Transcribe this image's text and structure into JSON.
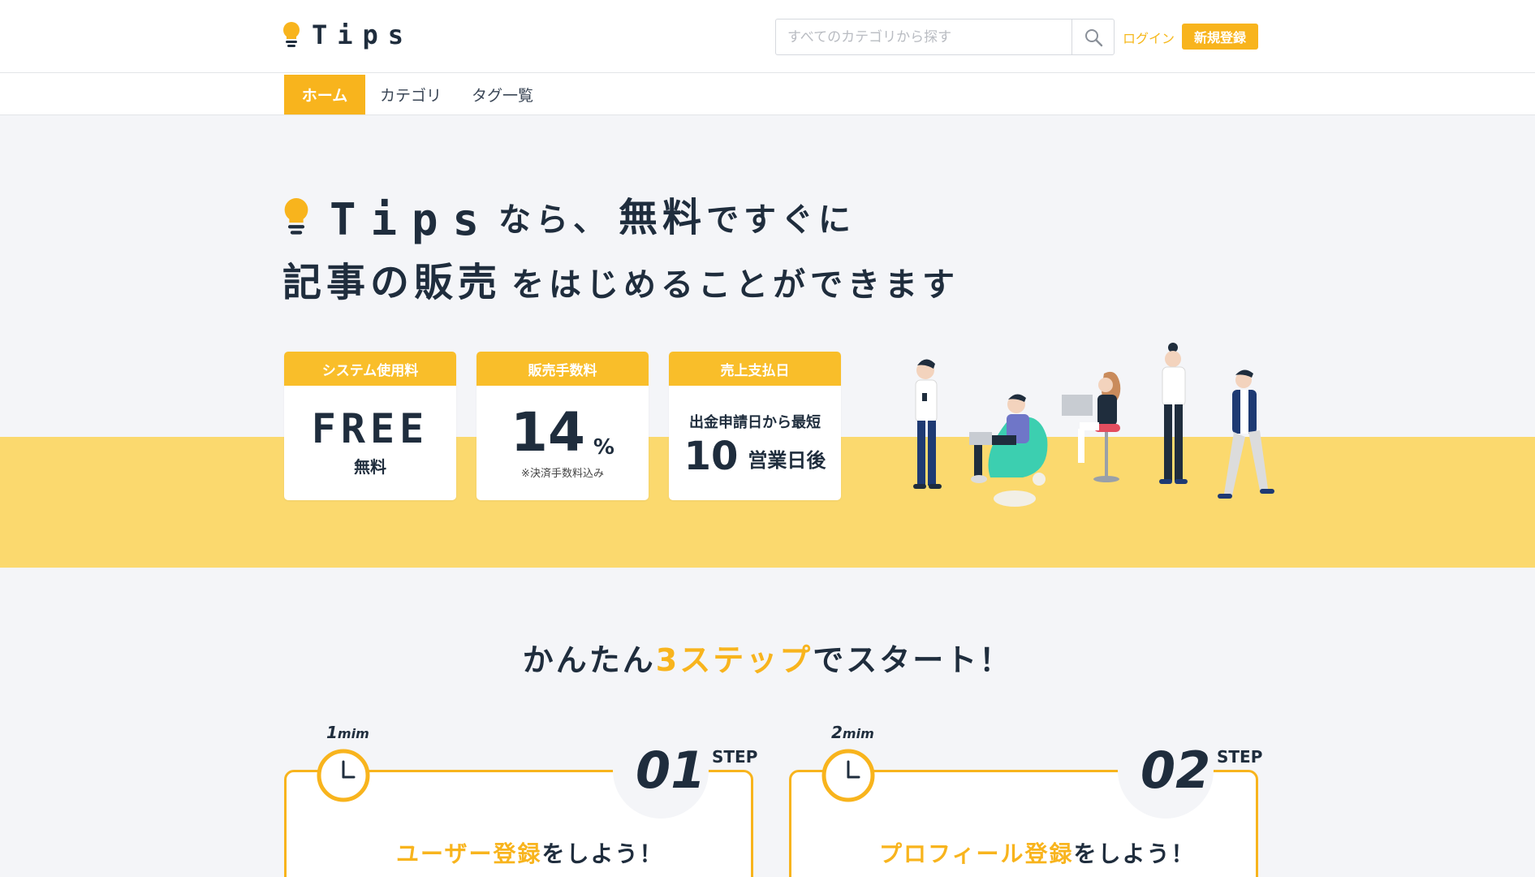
{
  "header": {
    "logo_text": "Tips",
    "search_placeholder": "すべてのカテゴリから探す",
    "login_label": "ログイン",
    "signup_label": "新規登録"
  },
  "nav": {
    "items": [
      {
        "label": "ホーム",
        "active": true
      },
      {
        "label": "カテゴリ",
        "active": false
      },
      {
        "label": "タグ一覧",
        "active": false
      }
    ]
  },
  "hero": {
    "brand": "Tips",
    "line1_part1": "なら、",
    "line1_part2": "無料",
    "line1_part3": "ですぐに",
    "line2_part1": "記事の販売",
    "line2_part2": "をはじめることができます"
  },
  "features": [
    {
      "head": "システム使用料",
      "value": "FREE",
      "sub": "無料"
    },
    {
      "head": "販売手数料",
      "value": "14",
      "unit": "%",
      "note": "※決済手数料込み"
    },
    {
      "head": "売上支払日",
      "line": "出金申請日から最短",
      "value": "10",
      "unit": "営業日後"
    }
  ],
  "steps_section": {
    "title_part1": "かんたん",
    "title_accent": "3ステップ",
    "title_part2": "でスタート！"
  },
  "steps": [
    {
      "minutes": "1",
      "minutes_unit": "mim",
      "number": "01",
      "step_label": "STEP",
      "heading_accent": "ユーザー登録",
      "heading_rest": "をしよう！"
    },
    {
      "minutes": "2",
      "minutes_unit": "mim",
      "number": "02",
      "step_label": "STEP",
      "heading_accent": "プロフィール登録",
      "heading_rest": "をしよう！"
    }
  ],
  "colors": {
    "accent": "#f8b41d",
    "hero_band": "#fbd96e",
    "page_bg": "#f4f5f8",
    "text_dark": "#1f2d3d"
  },
  "icons": {
    "logo": "lightbulb-icon",
    "search": "search-icon",
    "step": "clock-icon"
  }
}
